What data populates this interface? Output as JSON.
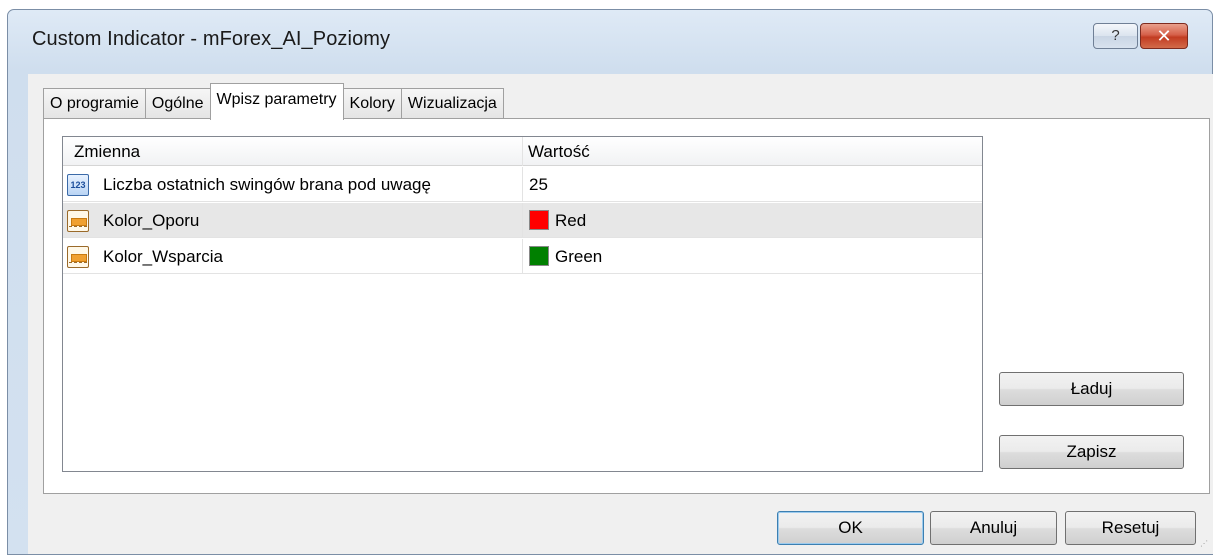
{
  "window": {
    "title": "Custom Indicator - mForex_AI_Poziomy",
    "help_label": "?",
    "close_label": "✕"
  },
  "tabs": [
    {
      "label": "O programie"
    },
    {
      "label": "Ogólne"
    },
    {
      "label": "Wpisz parametry",
      "active": true
    },
    {
      "label": "Kolory"
    },
    {
      "label": "Wizualizacja"
    }
  ],
  "grid": {
    "headers": [
      "Zmienna",
      "Wartość"
    ],
    "rows": [
      {
        "icon": "number-icon",
        "name": "Liczba ostatnich swingów brana pod uwagę",
        "value": "25"
      },
      {
        "icon": "color-param-icon",
        "name": "Kolor_Oporu",
        "value": "Red",
        "swatch": "#ff0000",
        "selected": true
      },
      {
        "icon": "color-param-icon",
        "name": "Kolor_Wsparcia",
        "value": "Green",
        "swatch": "#008000"
      }
    ]
  },
  "side_buttons": {
    "load": "Ładuj",
    "save": "Zapisz"
  },
  "footer": {
    "ok": "OK",
    "cancel": "Anuluj",
    "reset": "Resetuj"
  }
}
